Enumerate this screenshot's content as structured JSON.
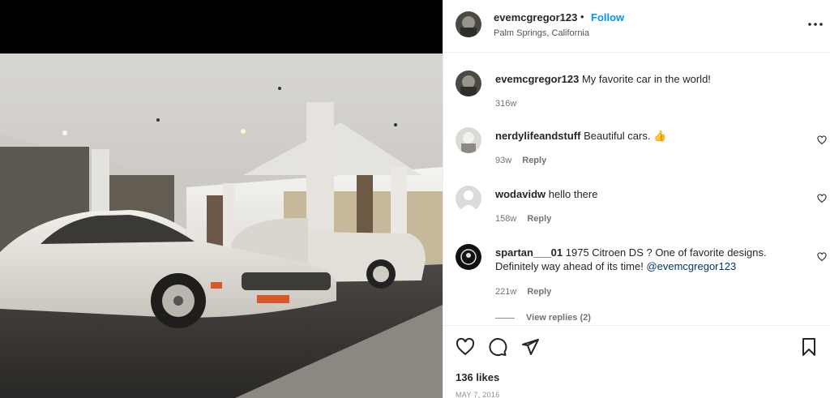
{
  "post": {
    "author": "evemcgregor123",
    "follow_label": "Follow",
    "separator": "•",
    "location": "Palm Springs, California",
    "likes": "136 likes",
    "date": "MAY 7, 2016"
  },
  "comments": [
    {
      "user": "evemcgregor123",
      "text": "My favorite car in the world!",
      "time": "316w",
      "reply": ""
    },
    {
      "user": "nerdylifeandstuff",
      "text": "Beautiful cars.",
      "emoji": "👍",
      "time": "93w",
      "reply": "Reply"
    },
    {
      "user": "wodavidw",
      "text": "hello there",
      "time": "158w",
      "reply": "Reply"
    },
    {
      "user": "spartan___01",
      "text": "1975 Citroen DS ? One of favorite designs. Definitely way ahead of its time!",
      "mention": "@evemcgregor123",
      "time": "221w",
      "reply": "Reply"
    }
  ],
  "view_replies": "View replies (2)",
  "icons": {
    "more": "more-horizontal-icon",
    "like": "heart-icon",
    "comment": "comment-icon",
    "share": "send-icon",
    "save": "bookmark-icon"
  },
  "colors": {
    "follow": "#0095f6",
    "text": "#262626",
    "muted": "#737373",
    "mention": "#00376b"
  }
}
